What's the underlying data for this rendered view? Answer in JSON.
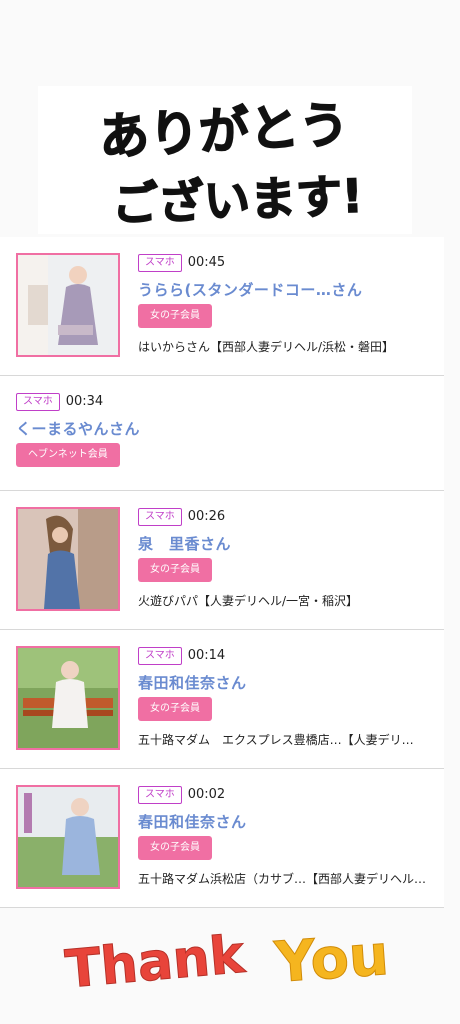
{
  "header": {
    "greeting_line1": "ありがとう",
    "greeting_line2": "ございます!"
  },
  "entries": [
    {
      "device": "スマホ",
      "time": "00:45",
      "name": "うらら(スタンダードコー…さん",
      "member": "女の子会員",
      "shop": "はいからさん【西部人妻デリヘル/浜松・磐田】",
      "has_photo": true
    },
    {
      "device": "スマホ",
      "time": "00:34",
      "name": "くーまるやんさん",
      "member": "ヘブンネット会員",
      "shop": "",
      "has_photo": false
    },
    {
      "device": "スマホ",
      "time": "00:26",
      "name": "泉　里香さん",
      "member": "女の子会員",
      "shop": "火遊びパパ【人妻デリヘル/一宮・稲沢】",
      "has_photo": true
    },
    {
      "device": "スマホ",
      "time": "00:14",
      "name": "春田和佳奈さん",
      "member": "女の子会員",
      "shop": "五十路マダム　エクスプレス豊橋店…【人妻デリ…",
      "has_photo": true
    },
    {
      "device": "スマホ",
      "time": "00:02",
      "name": "春田和佳奈さん",
      "member": "女の子会員",
      "shop": "五十路マダム浜松店（カサブ…【西部人妻デリヘル…",
      "has_photo": true
    }
  ],
  "footer": {
    "thank": "Thank",
    "you": "You"
  },
  "colors": {
    "accent_pink": "#f06fa3",
    "name_blue": "#6a8bd0",
    "badge_purple": "#c03fc8"
  }
}
